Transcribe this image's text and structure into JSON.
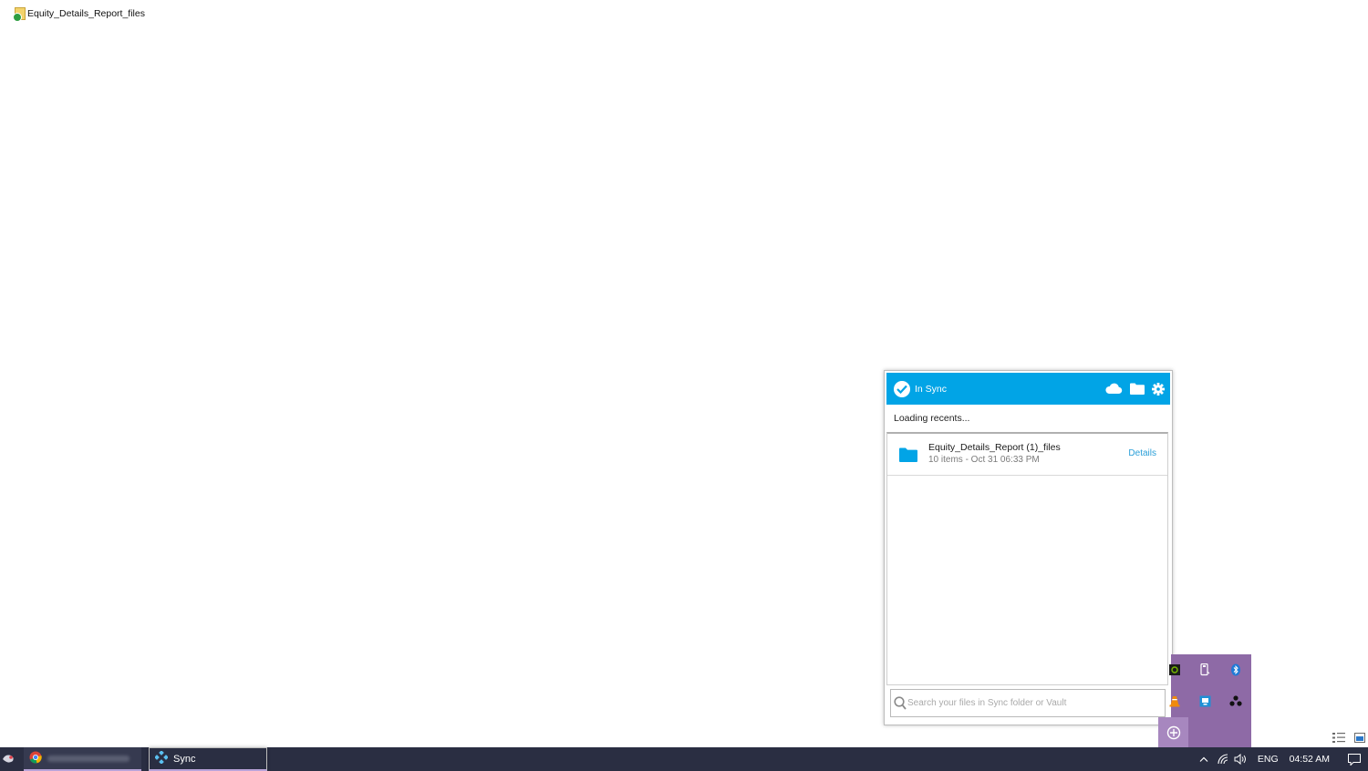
{
  "desktop": {
    "file_label": "Equity_Details_Report_files"
  },
  "sync_popup": {
    "status": "In Sync",
    "loading_text": "Loading recents...",
    "recent_items": [
      {
        "name": "Equity_Details_Report (1)_files",
        "meta": "10 items - Oct 31 06:33 PM",
        "action": "Details"
      }
    ],
    "search_placeholder": "Search your files in Sync folder or Vault",
    "tool_icons": [
      "cloud-icon",
      "folder-icon",
      "gear-icon"
    ]
  },
  "taskbar": {
    "apps": [
      {
        "label": "",
        "icon": "chrome-icon"
      },
      {
        "label": "Sync",
        "icon": "sync-icon"
      }
    ],
    "language": "ENG",
    "time": "04:52 AM"
  },
  "colors": {
    "sync_accent": "#01a4e6",
    "taskbar_bg": "#2a2e42",
    "tray_bg": "#8e6aa6",
    "link": "#2a9fd8"
  }
}
